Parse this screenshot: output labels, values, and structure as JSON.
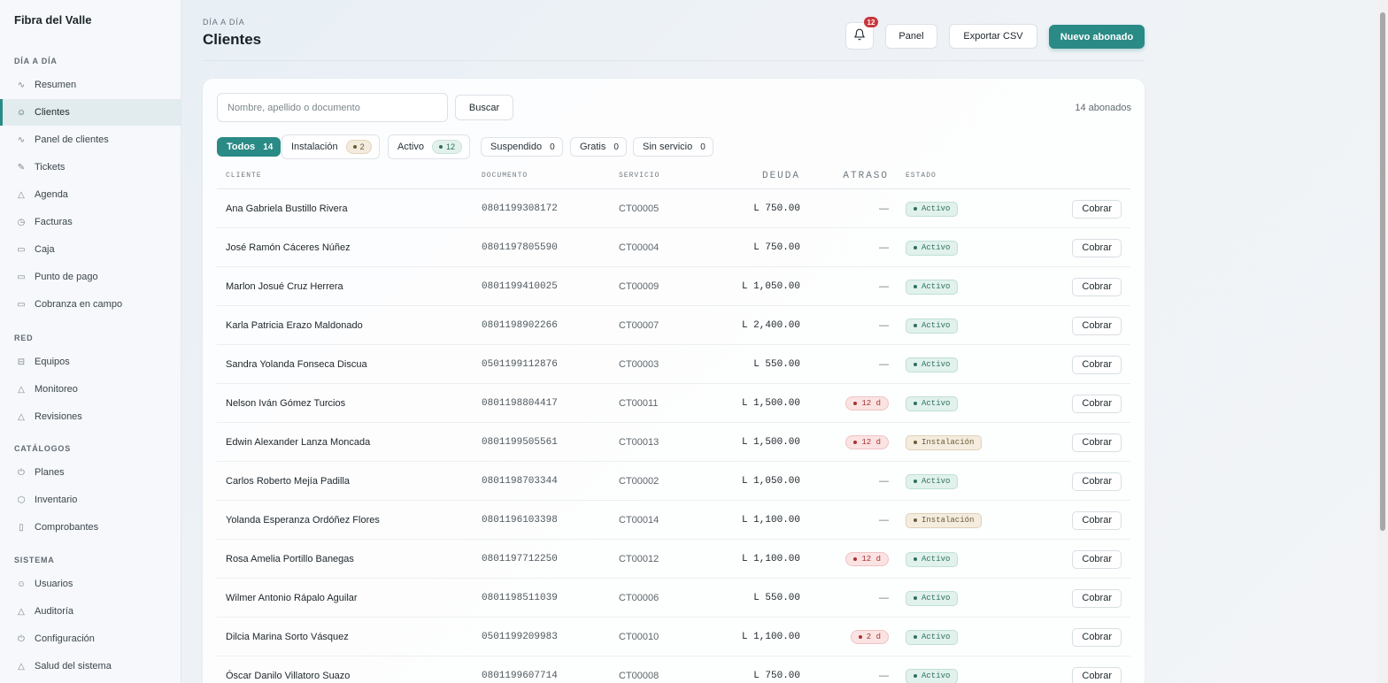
{
  "sidebar": {
    "brand": "Fibra del Valle",
    "sections": [
      {
        "title": "DÍA A DÍA",
        "items": [
          {
            "label": "Resumen",
            "icon": "activity-icon"
          },
          {
            "label": "Clientes",
            "icon": "users-icon",
            "active": true
          },
          {
            "label": "Panel de clientes",
            "icon": "activity-icon"
          },
          {
            "label": "Tickets",
            "icon": "wrench-icon"
          },
          {
            "label": "Agenda",
            "icon": "triangle-icon"
          },
          {
            "label": "Facturas",
            "icon": "clock-icon"
          },
          {
            "label": "Caja",
            "icon": "card-icon"
          },
          {
            "label": "Punto de pago",
            "icon": "card-icon"
          },
          {
            "label": "Cobranza en campo",
            "icon": "card-icon"
          }
        ]
      },
      {
        "title": "RED",
        "items": [
          {
            "label": "Equipos",
            "icon": "router-icon"
          },
          {
            "label": "Monitoreo",
            "icon": "triangle-icon"
          },
          {
            "label": "Revisiones",
            "icon": "triangle-icon"
          }
        ]
      },
      {
        "title": "CATÁLOGOS",
        "items": [
          {
            "label": "Planes",
            "icon": "power-icon"
          },
          {
            "label": "Inventario",
            "icon": "box-icon"
          },
          {
            "label": "Comprobantes",
            "icon": "document-icon"
          }
        ]
      },
      {
        "title": "SISTEMA",
        "items": [
          {
            "label": "Usuarios",
            "icon": "users-icon"
          },
          {
            "label": "Auditoría",
            "icon": "triangle-icon"
          },
          {
            "label": "Configuración",
            "icon": "power-icon"
          },
          {
            "label": "Salud del sistema",
            "icon": "triangle-icon"
          }
        ]
      }
    ]
  },
  "header": {
    "overline": "DÍA A DÍA",
    "title": "Clientes",
    "notifications_count": "12",
    "panel_label": "Panel",
    "export_label": "Exportar CSV",
    "new_label": "Nuevo abonado"
  },
  "search": {
    "placeholder": "Nombre, apellido o documento",
    "value": "",
    "button_label": "Buscar",
    "count_label": "14 abonados"
  },
  "filters": [
    {
      "label": "Todos",
      "count": "14",
      "style": "active"
    },
    {
      "label": "Instalación",
      "count": "2",
      "style": "warn"
    },
    {
      "label": "Activo",
      "count": "12",
      "style": "ok"
    },
    {
      "label": "Suspendido",
      "count": "0",
      "style": "plain"
    },
    {
      "label": "Gratis",
      "count": "0",
      "style": "plain"
    },
    {
      "label": "Sin servicio",
      "count": "0",
      "style": "plain"
    }
  ],
  "table": {
    "columns": {
      "cliente": "CLIENTE",
      "documento": "DOCUMENTO",
      "servicio": "SERVICIO",
      "deuda": "DEUDA",
      "atraso": "ATRASO",
      "estado": "ESTADO"
    },
    "action_label": "Cobrar",
    "rows": [
      {
        "name": "Ana Gabriela Bustillo Rivera",
        "doc": "0801199308172",
        "service": "CT00005",
        "debt": "L 750.00",
        "late": "",
        "state": "Activo"
      },
      {
        "name": "José Ramón Cáceres Núñez",
        "doc": "0801197805590",
        "service": "CT00004",
        "debt": "L 750.00",
        "late": "",
        "state": "Activo"
      },
      {
        "name": "Marlon Josué Cruz Herrera",
        "doc": "0801199410025",
        "service": "CT00009",
        "debt": "L 1,050.00",
        "late": "",
        "state": "Activo"
      },
      {
        "name": "Karla Patricia Erazo Maldonado",
        "doc": "0801198902266",
        "service": "CT00007",
        "debt": "L 2,400.00",
        "late": "",
        "state": "Activo"
      },
      {
        "name": "Sandra Yolanda Fonseca Discua",
        "doc": "0501199112876",
        "service": "CT00003",
        "debt": "L 550.00",
        "late": "",
        "state": "Activo"
      },
      {
        "name": "Nelson Iván Gómez Turcios",
        "doc": "0801198804417",
        "service": "CT00011",
        "debt": "L 1,500.00",
        "late": "12 d",
        "state": "Activo"
      },
      {
        "name": "Edwin Alexander Lanza Moncada",
        "doc": "0801199505561",
        "service": "CT00013",
        "debt": "L 1,500.00",
        "late": "12 d",
        "state": "Instalación"
      },
      {
        "name": "Carlos Roberto Mejía Padilla",
        "doc": "0801198703344",
        "service": "CT00002",
        "debt": "L 1,050.00",
        "late": "",
        "state": "Activo"
      },
      {
        "name": "Yolanda Esperanza Ordóñez Flores",
        "doc": "0801196103398",
        "service": "CT00014",
        "debt": "L 1,100.00",
        "late": "",
        "state": "Instalación"
      },
      {
        "name": "Rosa Amelia Portillo Banegas",
        "doc": "0801197712250",
        "service": "CT00012",
        "debt": "L 1,100.00",
        "late": "12 d",
        "state": "Activo"
      },
      {
        "name": "Wilmer Antonio Rápalo Aguilar",
        "doc": "0801198511039",
        "service": "CT00006",
        "debt": "L 550.00",
        "late": "",
        "state": "Activo"
      },
      {
        "name": "Dilcia Marina Sorto Vásquez",
        "doc": "0501199209983",
        "service": "CT00010",
        "debt": "L 1,100.00",
        "late": "2 d",
        "state": "Activo"
      },
      {
        "name": "Óscar Danilo Villatoro Suazo",
        "doc": "0801199607714",
        "service": "CT00008",
        "debt": "L 750.00",
        "late": "",
        "state": "Activo"
      }
    ],
    "no_late_symbol": "—"
  },
  "colors": {
    "accent": "#2a8a86",
    "badge": "#c9363b",
    "late_text": "#a83333",
    "active_text": "#2e6f5f",
    "install_text": "#6d5b34"
  }
}
